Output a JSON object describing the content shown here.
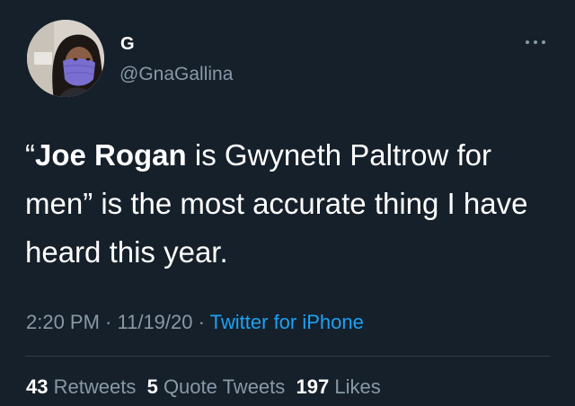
{
  "author": {
    "name": "G",
    "handle": "@GnaGallina",
    "avatar_icon": "profile-photo-masked-person-icon"
  },
  "menu_icon": "more-options-ellipsis-icon",
  "tweet": {
    "text_quote_open": "“",
    "text_bold": "Joe Rogan",
    "text_rest": " is Gwyneth Paltrow for men” is the most accurate thing I have heard this year."
  },
  "meta": {
    "time": "2:20 PM",
    "sep1": " · ",
    "date": "11/19/20",
    "sep2": " · ",
    "source": "Twitter for iPhone"
  },
  "stats": {
    "retweets_count": "43",
    "retweets_label": "Retweets",
    "quotes_count": "5",
    "quotes_label": "Quote Tweets",
    "likes_count": "197",
    "likes_label": "Likes"
  },
  "colors": {
    "background": "#15202b",
    "text": "#ffffff",
    "secondary": "#8899a6",
    "link": "#1da1f2"
  }
}
